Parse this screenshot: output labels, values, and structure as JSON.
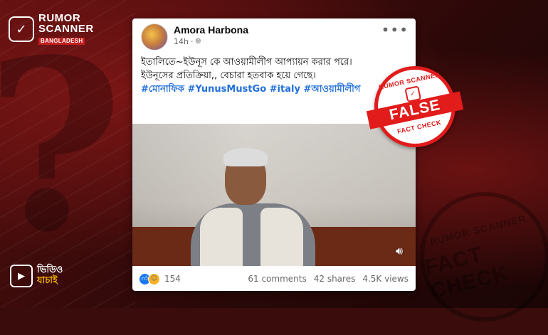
{
  "brand": {
    "line1": "RUMOR",
    "line2": "SCANNER",
    "line3": "BANGLADESH",
    "accent_color": "#c41e1e"
  },
  "video_badge": {
    "line1": "ভিডিও",
    "line2": "যাচাই",
    "icon": "video-play-icon"
  },
  "post": {
    "author": "Amora Harbona",
    "time": "14h",
    "privacy_icon": "globe-icon",
    "text_line1": "ইতালিতে~ইউনূস কে আওয়ামীলীগ আপ্যায়ন করার পরে।",
    "text_line2": "ইউনূসের প্রতিক্রিয়া,, বেচারা হতবাক হয়ে গেছে।",
    "hashtags": "#মোনাফিক #YunusMustGo #italy #আওয়ামীলীগ",
    "reaction_count": "154",
    "comments": "61 comments",
    "shares": "42 shares",
    "views": "4.5K views",
    "link_color": "#216fdb"
  },
  "stamp": {
    "top_text": "RUMOR SCANNER",
    "verdict": "FALSE",
    "bottom_text": "FACT CHECK",
    "color": "#e21b1b"
  },
  "ghost_stamp": {
    "top_text": "RUMOR SCANNER",
    "bottom_text": "FACT CHECK"
  }
}
